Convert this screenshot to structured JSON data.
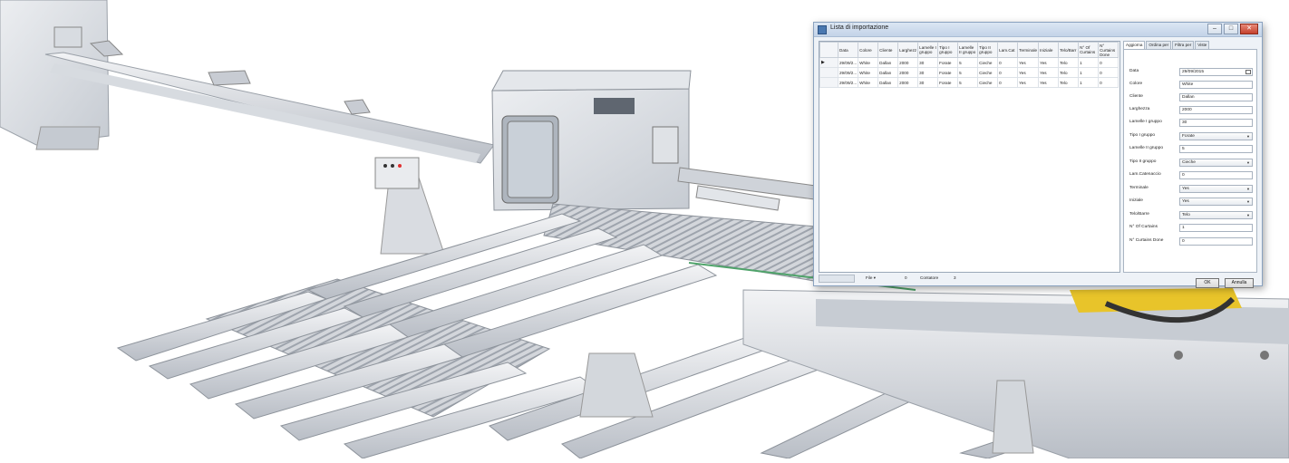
{
  "window": {
    "title": "Lista di importazione",
    "buttons": {
      "minimize": "–",
      "maximize": "□",
      "close": "✕"
    }
  },
  "grid": {
    "columns": [
      "Data",
      "Colore",
      "Cliente",
      "Larghezz",
      "Lamelle I gruppo",
      "Tipo I gruppo",
      "Lamelle II gruppo",
      "Tipo II gruppo",
      "Lam.Cat",
      "Terminale",
      "Iniziale",
      "Telo/Barr",
      "N° Of Curtains",
      "N° Curtains Done"
    ],
    "rows": [
      [
        "29/09/2...",
        "White",
        "Dallan",
        "2000",
        "30",
        "Forate",
        "5",
        "Cieche",
        "0",
        "Yes",
        "Yes",
        "Telo",
        "1",
        "0"
      ],
      [
        "29/09/2...",
        "White",
        "Dallan",
        "2000",
        "30",
        "Forate",
        "5",
        "Cieche",
        "0",
        "Yes",
        "Yes",
        "Telo",
        "1",
        "0"
      ],
      [
        "29/09/2...",
        "White",
        "Dallan",
        "2000",
        "30",
        "Forate",
        "5",
        "Cieche",
        "0",
        "Yes",
        "Yes",
        "Telo",
        "1",
        "0"
      ]
    ],
    "current_row_marker": "▶"
  },
  "status": {
    "file_label": "File",
    "file_value": "0",
    "contatore_label": "Contatore",
    "contatore_value": "3"
  },
  "panel": {
    "tabs": [
      "Aggiorna",
      "Ordina per",
      "Filtra per",
      "Viste"
    ],
    "fields": [
      {
        "label": "Data",
        "value": "29/09/2015",
        "type": "date"
      },
      {
        "label": "Colore",
        "value": "White",
        "type": "text"
      },
      {
        "label": "Cliente",
        "value": "Dallan",
        "type": "text"
      },
      {
        "label": "Larghezza",
        "value": "2000",
        "type": "text"
      },
      {
        "label": "Lamelle I gruppo",
        "value": "30",
        "type": "text"
      },
      {
        "label": "Tipo I gruppo",
        "value": "Forate",
        "type": "select"
      },
      {
        "label": "Lamelle II gruppo",
        "value": "5",
        "type": "text"
      },
      {
        "label": "Tipo II gruppo",
        "value": "Cieche",
        "type": "select"
      },
      {
        "label": "Lam.Catenaccio",
        "value": "0",
        "type": "text"
      },
      {
        "label": "Terminale",
        "value": "Yes",
        "type": "select"
      },
      {
        "label": "Iniziale",
        "value": "Yes",
        "type": "select"
      },
      {
        "label": "Telo/Barre",
        "value": "Telo",
        "type": "select"
      },
      {
        "label": "N° Of Curtains",
        "value": "1",
        "type": "text"
      },
      {
        "label": "N° Curtains Done",
        "value": "0",
        "type": "text"
      }
    ],
    "ok_label": "OK",
    "cancel_label": "Annulla"
  }
}
